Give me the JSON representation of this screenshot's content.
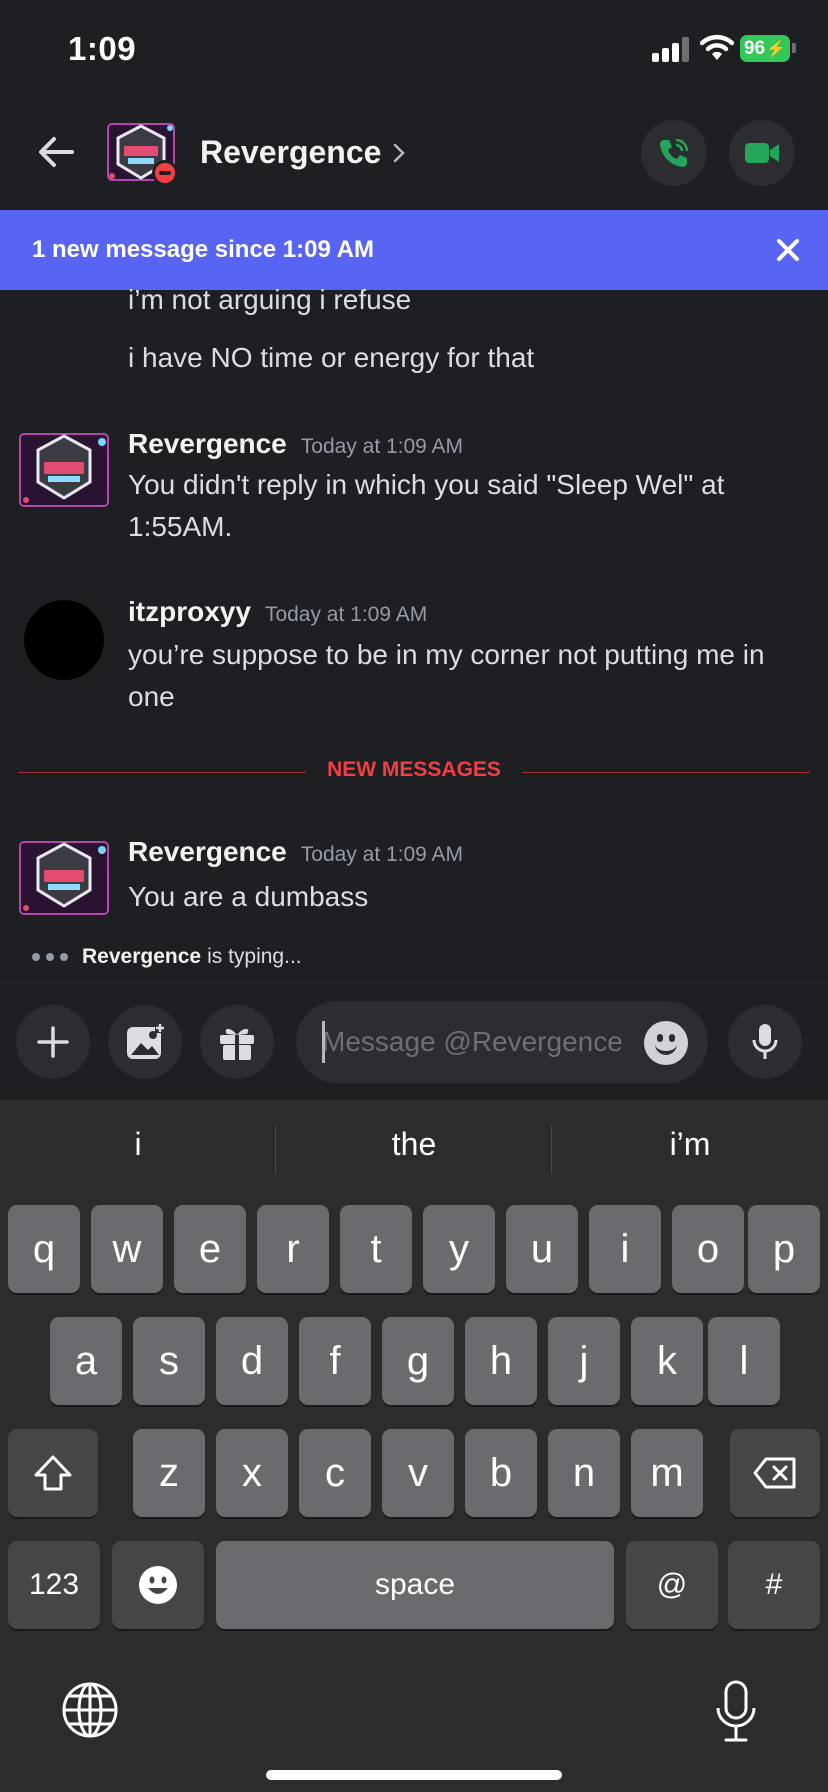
{
  "status_bar": {
    "time": "1:09",
    "battery": "96"
  },
  "header": {
    "title": "Revergence",
    "back_icon": "arrow-left-icon",
    "call_icon": "phone-icon",
    "video_icon": "video-camera-icon",
    "accent_green": "#23a55a"
  },
  "banner": {
    "text": "1 new message since 1:09 AM",
    "color": "#5865f2"
  },
  "messages": {
    "earlier_lines": [
      "i’m not arguing i refuse",
      "i have NO time or energy for that"
    ],
    "items": [
      {
        "author": "Revergence",
        "time": "Today at 1:09 AM",
        "text": "You didn't reply in which you said \"Sleep Wel\" at 1:55AM."
      },
      {
        "author": "itzproxyy",
        "time": "Today at 1:09 AM",
        "text": "you’re suppose to be in my corner not putting me in one"
      },
      {
        "author": "Revergence",
        "time": "Today at 1:09 AM",
        "text": "You are a dumbass"
      }
    ],
    "new_divider": "NEW MESSAGES",
    "new_divider_color": "#f23f43",
    "typing_user": "Revergence",
    "typing_suffix": "is typing..."
  },
  "input": {
    "placeholder": "Message @Revergence"
  },
  "keyboard": {
    "suggestions": [
      "i",
      "the",
      "i’m"
    ],
    "row1": [
      "q",
      "w",
      "e",
      "r",
      "t",
      "y",
      "u",
      "i",
      "o",
      "p"
    ],
    "row2": [
      "a",
      "s",
      "d",
      "f",
      "g",
      "h",
      "j",
      "k",
      "l"
    ],
    "row3": [
      "z",
      "x",
      "c",
      "v",
      "b",
      "n",
      "m"
    ],
    "numbers_label": "123",
    "space_label": "space",
    "at_label": "@",
    "hash_label": "#"
  }
}
